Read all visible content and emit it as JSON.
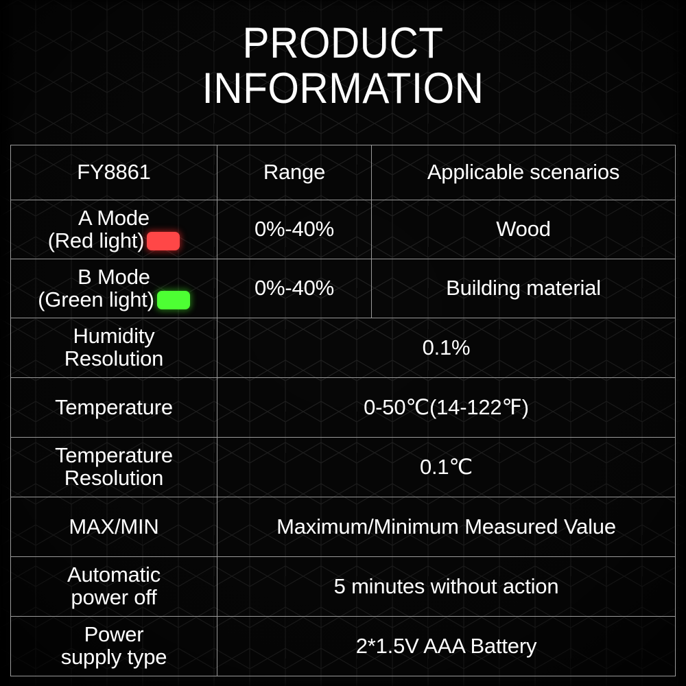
{
  "title": {
    "line1": "PRODUCT",
    "line2": "INFORMATION"
  },
  "table": {
    "header": {
      "model": "FY8861",
      "range": "Range",
      "scenarios": "Applicable scenarios"
    },
    "rows": [
      {
        "label_line1": "A Mode",
        "label_line2": "(Red light)",
        "indicator_color": "#ff4747",
        "indicator_name": "red-light-swatch",
        "range": "0%-40%",
        "scenario": "Wood"
      },
      {
        "label_line1": "B Mode",
        "label_line2": "(Green light)",
        "indicator_color": "#4dff33",
        "indicator_name": "green-light-swatch",
        "range": "0%-40%",
        "scenario": "Building material"
      },
      {
        "label_line1": "Humidity",
        "label_line2": "Resolution",
        "value": "0.1%"
      },
      {
        "label_line1": "Temperature",
        "label_line2": "",
        "value": "0-50℃(14-122℉)"
      },
      {
        "label_line1": "Temperature",
        "label_line2": "Resolution",
        "value": "0.1℃"
      },
      {
        "label_line1": "MAX/MIN",
        "label_line2": "",
        "value": "Maximum/Minimum Measured Value"
      },
      {
        "label_line1": "Automatic",
        "label_line2": "power off",
        "value": "5 minutes without action"
      },
      {
        "label_line1": "Power",
        "label_line2": "supply type",
        "value": "2*1.5V AAA Battery"
      }
    ]
  },
  "colors": {
    "background": "#070707",
    "hex_line": "#242424",
    "table_border": "#9a9a9a",
    "text": "#ffffff",
    "red_indicator": "#ff4747",
    "green_indicator": "#4dff33"
  }
}
